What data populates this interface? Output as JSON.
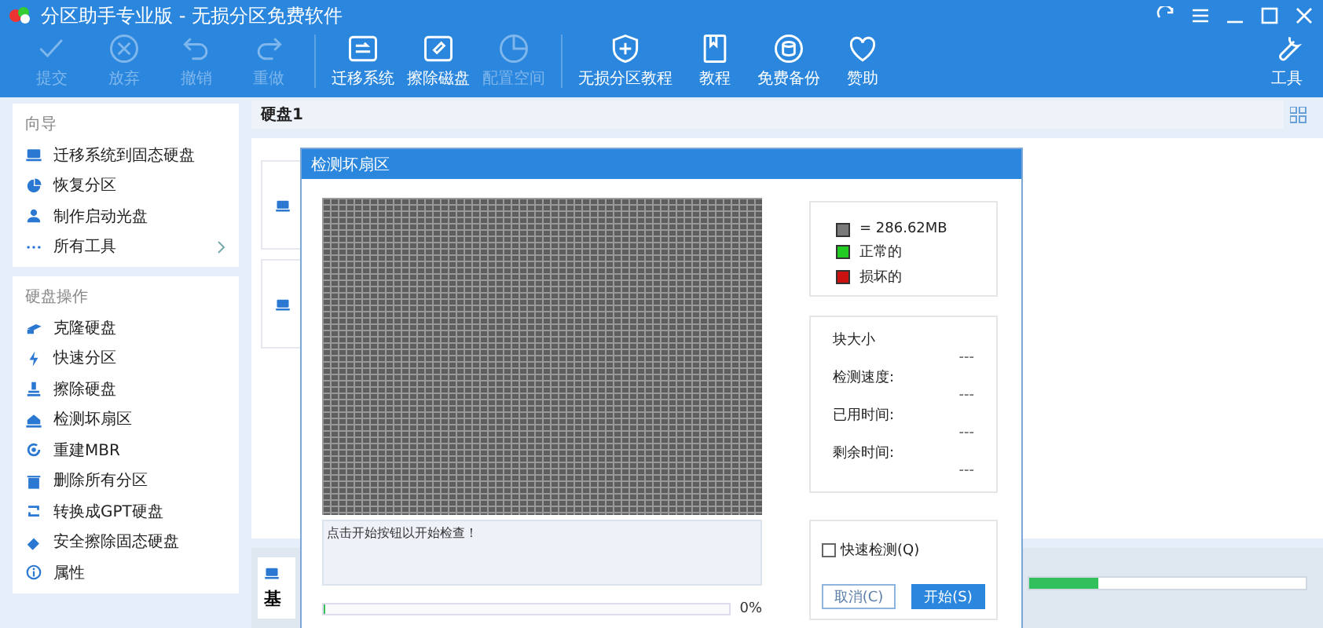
{
  "window": {
    "title": "分区助手专业版 - 无损分区免费软件"
  },
  "toolbar_groups": [
    [
      {
        "label": "提交",
        "disabled": true
      },
      {
        "label": "放弃",
        "disabled": true
      },
      {
        "label": "撤销",
        "disabled": true
      },
      {
        "label": "重做",
        "disabled": true
      }
    ],
    [
      {
        "label": "迁移系统",
        "disabled": false
      },
      {
        "label": "擦除磁盘",
        "disabled": false
      },
      {
        "label": "配置空间",
        "disabled": true
      }
    ],
    [
      {
        "label": "无损分区教程",
        "disabled": false
      },
      {
        "label": "教程",
        "disabled": false
      },
      {
        "label": "免费备份",
        "disabled": false
      },
      {
        "label": "赞助",
        "disabled": false
      }
    ]
  ],
  "tools_button": {
    "label": "工具"
  },
  "sidebar": [
    {
      "heading": "向导",
      "items": [
        {
          "label": "迁移系统到固态硬盘",
          "submenu": false
        },
        {
          "label": "恢复分区",
          "submenu": false
        },
        {
          "label": "制作启动光盘",
          "submenu": false
        },
        {
          "label": "所有工具",
          "submenu": true
        }
      ]
    },
    {
      "heading": "硬盘操作",
      "items": [
        {
          "label": "克隆硬盘",
          "submenu": false
        },
        {
          "label": "快速分区",
          "submenu": false
        },
        {
          "label": "擦除硬盘",
          "submenu": false
        },
        {
          "label": "检测坏扇区",
          "submenu": false
        },
        {
          "label": "重建MBR",
          "submenu": false
        },
        {
          "label": "删除所有分区",
          "submenu": false
        },
        {
          "label": "转换成GPT硬盘",
          "submenu": false
        },
        {
          "label": "安全擦除固态硬盘",
          "submenu": false
        },
        {
          "label": "属性",
          "submenu": false
        }
      ]
    }
  ],
  "main": {
    "disk_header": "硬盘1",
    "disk_card": {
      "label": "基",
      "level": 0.25
    }
  },
  "dialog": {
    "title": "检测坏扇区",
    "legend": [
      {
        "label": "= 286.62MB",
        "color": "#7a7a7a"
      },
      {
        "label": "正常的",
        "color": "#22cc22"
      },
      {
        "label": "损坏的",
        "color": "#cc1111"
      }
    ],
    "stats": [
      {
        "label": "块大小",
        "value": "---"
      },
      {
        "label": "检测速度:",
        "value": "---"
      },
      {
        "label": "已用时间:",
        "value": "---"
      },
      {
        "label": "剩余时间:",
        "value": "---"
      }
    ],
    "message": "点击开始按钮以开始检查！",
    "progress": {
      "level": 0,
      "reading": "0%"
    },
    "quick_check": {
      "label": "快速检测(Q)",
      "checked": false
    },
    "buttons": [
      {
        "label": "取消(C)",
        "kind": "secondary"
      },
      {
        "label": "开始(S)",
        "kind": "primary"
      }
    ]
  }
}
